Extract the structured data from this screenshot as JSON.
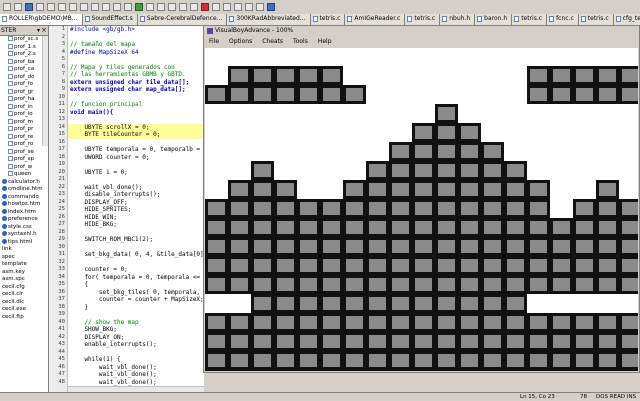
{
  "tabs": [
    {
      "label": "ROLLER\\gbDEMO\\MB...",
      "active": true
    },
    {
      "label": "SoundEffect.s",
      "active": false
    },
    {
      "label": "Sabre-CerebralDefence...",
      "active": false
    },
    {
      "label": "300KRadAbbreviated...",
      "active": false
    },
    {
      "label": "tetris.c",
      "active": false
    },
    {
      "label": "AmIGeReader.c",
      "active": false
    },
    {
      "label": "tetris.c",
      "active": false
    },
    {
      "label": "nbuh.h",
      "active": false
    },
    {
      "label": "baron.h",
      "active": false
    },
    {
      "label": "tetris.c",
      "active": false
    },
    {
      "label": "fcnc.c",
      "active": false
    },
    {
      "label": "tetris.c",
      "active": false
    },
    {
      "label": "cfg_tetris.h",
      "active": false
    },
    {
      "label": "tile.c",
      "active": false
    },
    {
      "label": "backgroundsc",
      "active": false
    }
  ],
  "left_panel": {
    "header": "STER",
    "items": [
      {
        "icon": "file-icon",
        "label": "prof_sc.s"
      },
      {
        "icon": "file-icon",
        "label": "prof_1.s"
      },
      {
        "icon": "file-icon",
        "label": "prof_2.s"
      },
      {
        "icon": "file-icon",
        "label": "prof_ba"
      },
      {
        "icon": "file-icon",
        "label": "prof_ca"
      },
      {
        "icon": "file-icon",
        "label": "prof_do"
      },
      {
        "icon": "file-icon",
        "label": "prof_fo"
      },
      {
        "icon": "file-icon",
        "label": "prof_gr"
      },
      {
        "icon": "file-icon",
        "label": "prof_ha"
      },
      {
        "icon": "file-icon",
        "label": "prof_in"
      },
      {
        "icon": "file-icon",
        "label": "prof_lo"
      },
      {
        "icon": "file-icon",
        "label": "prof_m"
      },
      {
        "icon": "file-icon",
        "label": "prof_pr"
      },
      {
        "icon": "file-icon",
        "label": "prof_re"
      },
      {
        "icon": "file-icon",
        "label": "prof_ro"
      },
      {
        "icon": "file-icon",
        "label": "prof_se"
      },
      {
        "icon": "file-icon",
        "label": "prof_sp"
      },
      {
        "icon": "file-icon",
        "label": "prof_w"
      },
      {
        "icon": "file-icon",
        "label": "queen"
      },
      {
        "icon": "ball-icon",
        "label": "calculator.h"
      },
      {
        "icon": "ball-icon",
        "label": "cmdline.htm"
      },
      {
        "icon": "ball-icon",
        "label": "commando"
      },
      {
        "icon": "ball-icon",
        "label": "howtos.htm"
      },
      {
        "icon": "ball-icon",
        "label": "index.htm"
      },
      {
        "icon": "ball-icon",
        "label": "preference"
      },
      {
        "icon": "ball-icon",
        "label": "style.css"
      },
      {
        "icon": "ball-icon",
        "label": "syntaxhl.h"
      },
      {
        "icon": "ball-icon",
        "label": "tips.html"
      },
      {
        "icon": "none",
        "label": "link"
      },
      {
        "icon": "none",
        "label": "spec"
      },
      {
        "icon": "none",
        "label": "template"
      },
      {
        "icon": "none",
        "label": "asm.key"
      },
      {
        "icon": "none",
        "label": "asm.spc"
      },
      {
        "icon": "none",
        "label": "cecil.cfg"
      },
      {
        "icon": "none",
        "label": "cecil.clr"
      },
      {
        "icon": "none",
        "label": "cecil.dic"
      },
      {
        "icon": "none",
        "label": "cecil.exe"
      },
      {
        "icon": "none",
        "label": "cecil.ftp"
      }
    ]
  },
  "code": {
    "start_line": 1,
    "highlight_lines": [
      14,
      15
    ],
    "lines": [
      {
        "cls": "c-pp",
        "text": "#include <gb/gb.h>"
      },
      {
        "cls": "c-txt",
        "text": ""
      },
      {
        "cls": "c-cmt",
        "text": "// tamaño del mapa"
      },
      {
        "cls": "c-pp",
        "text": "#define MapSizeX 64"
      },
      {
        "cls": "c-txt",
        "text": ""
      },
      {
        "cls": "c-cmt",
        "text": "// Mapa y tiles generados con"
      },
      {
        "cls": "c-cmt",
        "text": "// las herramientas GBMB y GBTD."
      },
      {
        "cls": "c-kw",
        "text": "extern unsigned char tile_data[];"
      },
      {
        "cls": "c-kw",
        "text": "extern unsigned char map_data[];"
      },
      {
        "cls": "c-txt",
        "text": ""
      },
      {
        "cls": "c-cmt",
        "text": "// funcion principal"
      },
      {
        "cls": "c-kw",
        "text": "void main(){"
      },
      {
        "cls": "c-txt",
        "text": ""
      },
      {
        "cls": "c-txt",
        "text": "    UBYTE scrollX = 0;"
      },
      {
        "cls": "c-txt",
        "text": "    BYTE tileCounter = 0;"
      },
      {
        "cls": "c-txt",
        "text": ""
      },
      {
        "cls": "c-txt",
        "text": "    UBYTE temporala = 0, temporalb = 0;"
      },
      {
        "cls": "c-txt",
        "text": "    UWORD counter = 0;"
      },
      {
        "cls": "c-txt",
        "text": ""
      },
      {
        "cls": "c-txt",
        "text": "    UBYTE i = 0;"
      },
      {
        "cls": "c-txt",
        "text": ""
      },
      {
        "cls": "c-txt",
        "text": "    wait_vbl_done();"
      },
      {
        "cls": "c-txt",
        "text": "    disable_interrupts();"
      },
      {
        "cls": "c-txt",
        "text": "    DISPLAY_OFF;"
      },
      {
        "cls": "c-txt",
        "text": "    HIDE_SPRITES;"
      },
      {
        "cls": "c-txt",
        "text": "    HIDE_WIN;"
      },
      {
        "cls": "c-txt",
        "text": "    HIDE_BKG;"
      },
      {
        "cls": "c-txt",
        "text": ""
      },
      {
        "cls": "c-txt",
        "text": "    SWITCH_ROM_MBC1(2);"
      },
      {
        "cls": "c-txt",
        "text": ""
      },
      {
        "cls": "c-txt",
        "text": "    set_bkg_data( 0, 4, &tile_data[0] );"
      },
      {
        "cls": "c-txt",
        "text": ""
      },
      {
        "cls": "c-txt",
        "text": "    counter = 0;"
      },
      {
        "cls": "c-txt",
        "text": "    for( temporala = 0, temporala <= 17"
      },
      {
        "cls": "c-txt",
        "text": "    {"
      },
      {
        "cls": "c-txt",
        "text": "        set_bkg_tiles( 0, temporala, 20,"
      },
      {
        "cls": "c-txt",
        "text": "        counter = counter + MapSizeX;"
      },
      {
        "cls": "c-txt",
        "text": "    }"
      },
      {
        "cls": "c-txt",
        "text": ""
      },
      {
        "cls": "c-cmt",
        "text": "    // show the map"
      },
      {
        "cls": "c-txt",
        "text": "    SHOW_BKG;"
      },
      {
        "cls": "c-txt",
        "text": "    DISPLAY_ON;"
      },
      {
        "cls": "c-txt",
        "text": "    enable_interrupts();"
      },
      {
        "cls": "c-txt",
        "text": ""
      },
      {
        "cls": "c-txt",
        "text": "    while(1) {"
      },
      {
        "cls": "c-txt",
        "text": "        wait_vbl_done();"
      },
      {
        "cls": "c-txt",
        "text": "        wait_vbl_done();"
      },
      {
        "cls": "c-txt",
        "text": "        wait_vbl_done();"
      }
    ]
  },
  "emulator": {
    "title": "VisualBoyAdvance - 100%",
    "menu": [
      "File",
      "Options",
      "Cheats",
      "Tools",
      "Help"
    ],
    "tile_color": "#8a8a8a",
    "border_color": "#111111",
    "rows": [
      [
        1,
        [
          1,
          2,
          3,
          4,
          5
        ],
        [
          14,
          15,
          16,
          17,
          18
        ]
      ],
      [
        2,
        [
          0,
          1,
          2,
          3,
          4,
          5,
          6
        ],
        [
          14,
          15,
          16,
          17,
          18,
          19
        ]
      ],
      [
        3,
        [
          10
        ]
      ],
      [
        4,
        [
          9,
          10,
          11
        ]
      ],
      [
        5,
        [
          8,
          9,
          10,
          11,
          12
        ]
      ],
      [
        6,
        [
          2,
          7,
          8,
          9,
          10,
          11,
          12,
          13
        ]
      ],
      [
        7,
        [
          1,
          2,
          3,
          6,
          7,
          8,
          9,
          10,
          11,
          12,
          13,
          14,
          17
        ]
      ],
      [
        8,
        [
          0,
          1,
          2,
          3,
          4,
          5,
          6,
          7,
          8,
          9,
          10,
          11,
          12,
          13,
          14,
          16,
          17,
          18
        ]
      ],
      [
        9,
        [
          0,
          1,
          2,
          3,
          4,
          5,
          6,
          7,
          8,
          9,
          10,
          11,
          12,
          13,
          14,
          15,
          16,
          17,
          18,
          19
        ]
      ],
      [
        10,
        [
          0,
          1,
          2,
          3,
          4,
          5,
          6,
          7,
          8,
          9,
          10,
          11,
          12,
          13,
          14,
          15,
          16,
          17,
          18,
          19
        ]
      ],
      [
        11,
        [
          0,
          1,
          2,
          3,
          4,
          5,
          6,
          7,
          8,
          9,
          10,
          11,
          12,
          13,
          14,
          15,
          16,
          17,
          18,
          19
        ]
      ],
      [
        12,
        [
          0,
          1,
          2,
          3,
          4,
          5,
          6,
          7,
          8,
          9,
          10,
          11,
          12,
          13,
          14,
          15,
          16,
          17,
          18,
          19
        ]
      ],
      [
        13,
        [
          2,
          3,
          4,
          5,
          6,
          7,
          8,
          9,
          10,
          11,
          12,
          13
        ]
      ],
      [
        14,
        [
          0,
          1,
          2,
          3,
          4,
          5,
          6,
          7,
          8,
          9,
          10,
          11,
          12,
          13,
          14,
          15,
          16,
          17,
          18,
          19
        ]
      ],
      [
        15,
        [
          0,
          1,
          2,
          3,
          4,
          5,
          6,
          7,
          8,
          9,
          10,
          11,
          12,
          13,
          14,
          15,
          16,
          17,
          18,
          19
        ]
      ],
      [
        16,
        [
          0,
          1,
          2,
          3,
          4,
          5,
          6,
          7,
          8,
          9,
          10,
          11,
          12,
          13,
          14,
          15,
          16,
          17,
          18,
          19
        ]
      ],
      [
        17,
        [
          0,
          1,
          2,
          3,
          4,
          5,
          6,
          7,
          8,
          9,
          10,
          11,
          12,
          13,
          14,
          15,
          16,
          17,
          18,
          19
        ]
      ]
    ]
  },
  "status": {
    "position": "Ln 15, Co 23",
    "col": "78",
    "mode": "DOS  READ  INS"
  }
}
